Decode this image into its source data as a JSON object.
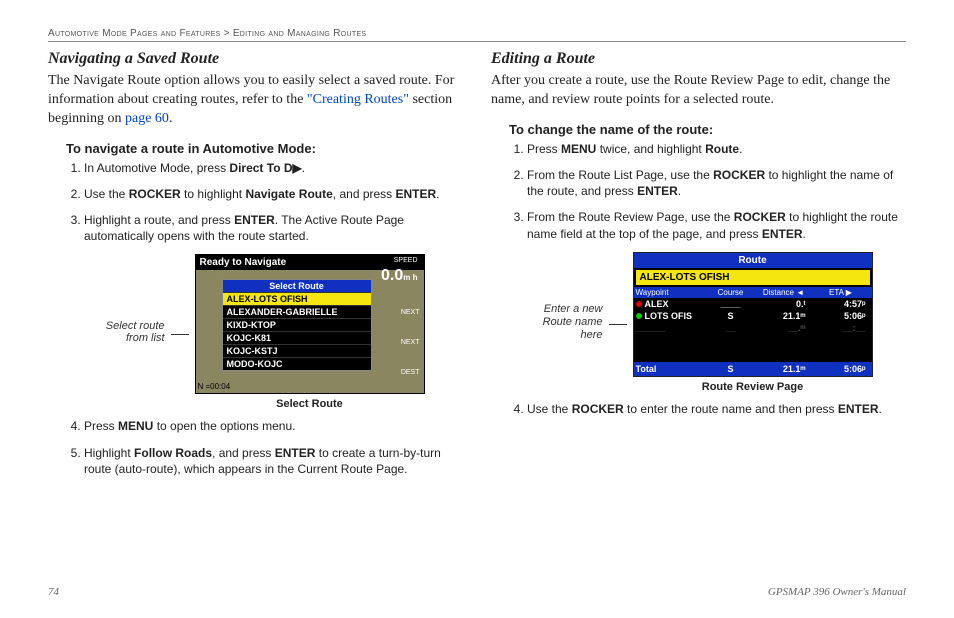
{
  "breadcrumb": {
    "section": "Automotive Mode Pages and Features",
    "sep": " > ",
    "sub": "Editing and Managing Routes"
  },
  "left": {
    "heading": "Navigating a Saved Route",
    "intro_a": "The Navigate Route option allows you to easily select a saved route. For information about creating routes, refer to the ",
    "intro_link": "\"Creating Routes\"",
    "intro_b": " section beginning on ",
    "intro_pagelink": "page 60",
    "intro_c": ".",
    "task": "To navigate a route in Automotive Mode:",
    "step1_a": "In Automotive Mode, press ",
    "step1_b": "Direct To ",
    "step1_icon": "D▶",
    "step1_c": ".",
    "step2_a": "Use the ",
    "step2_b": "ROCKER",
    "step2_c": " to highlight ",
    "step2_d": "Navigate Route",
    "step2_e": ", and press ",
    "step2_f": "ENTER",
    "step2_g": ".",
    "step3_a": "Highlight a route, and press ",
    "step3_b": "ENTER",
    "step3_c": ". The Active Route Page automatically opens with the route started.",
    "callout": "Select route from list",
    "figcap": "Select Route",
    "step4_a": "Press ",
    "step4_b": "MENU",
    "step4_c": " to open the options menu.",
    "step5_a": "Highlight ",
    "step5_b": "Follow Roads",
    "step5_c": ", and press ",
    "step5_d": "ENTER",
    "step5_e": " to create a turn-by-turn route (auto-route), which appears in the Current Route Page."
  },
  "screen1": {
    "topbar": "Ready to Navigate",
    "speed_label": "SPEED",
    "speed": "0.0",
    "speed_unit": "m h",
    "label_next": "NEXT",
    "label_next2": "NEXT",
    "label_dest": "DEST",
    "popup_title": "Select Route",
    "items": [
      "ALEX-LOTS OFISH",
      "ALEXANDER-GABRIELLE",
      "KIXD-KTOP",
      "KOJC-K81",
      "KOJC-KSTJ",
      "MODO-KOJC"
    ],
    "bottomleft": "N  =00:04"
  },
  "right": {
    "heading": "Editing a Route",
    "intro": "After you create a route, use the Route Review Page to edit, change the name, and review route points for a selected route.",
    "task": "To change the name of the route:",
    "step1_a": "Press ",
    "step1_b": "MENU",
    "step1_c": " twice, and highlight ",
    "step1_d": "Route",
    "step1_e": ".",
    "step2_a": "From the Route List Page, use the ",
    "step2_b": "ROCKER",
    "step2_c": " to highlight the name of the route, and press ",
    "step2_d": "ENTER",
    "step2_e": ".",
    "step3_a": "From the Route Review Page, use the ",
    "step3_b": "ROCKER",
    "step3_c": " to highlight the route name field at the top of the page, and press ",
    "step3_d": "ENTER",
    "step3_e": ".",
    "callout": "Enter a new Route name here",
    "figcap": "Route Review Page",
    "step4_a": "Use the ",
    "step4_b": "ROCKER",
    "step4_c": " to enter the route name and then press ",
    "step4_d": "ENTER",
    "step4_e": "."
  },
  "screen2": {
    "title": "Route",
    "namebox": "ALEX-LOTS OFISH",
    "head": [
      "Waypoint",
      "Course",
      "Distance ◄",
      "ETA  ▶"
    ],
    "rows": [
      {
        "dot": "r",
        "wp": "ALEX",
        "course": "____",
        "dist": "0.ᵗ",
        "eta": "4:57ᵖ"
      },
      {
        "dot": "g",
        "wp": "LOTS OFIS",
        "course": "S",
        "dist": "21.1ᵐ",
        "eta": "5:06ᵖ"
      },
      {
        "dot": "",
        "wp": "______",
        "course": "__",
        "dist": "__.ᵐ",
        "eta": "__:__ "
      }
    ],
    "total": {
      "label": "Total",
      "course": "S",
      "dist": "21.1ᵐ",
      "eta": "5:06ᵖ"
    }
  },
  "footer": {
    "page": "74",
    "manual": "GPSMAP 396 Owner's Manual"
  }
}
